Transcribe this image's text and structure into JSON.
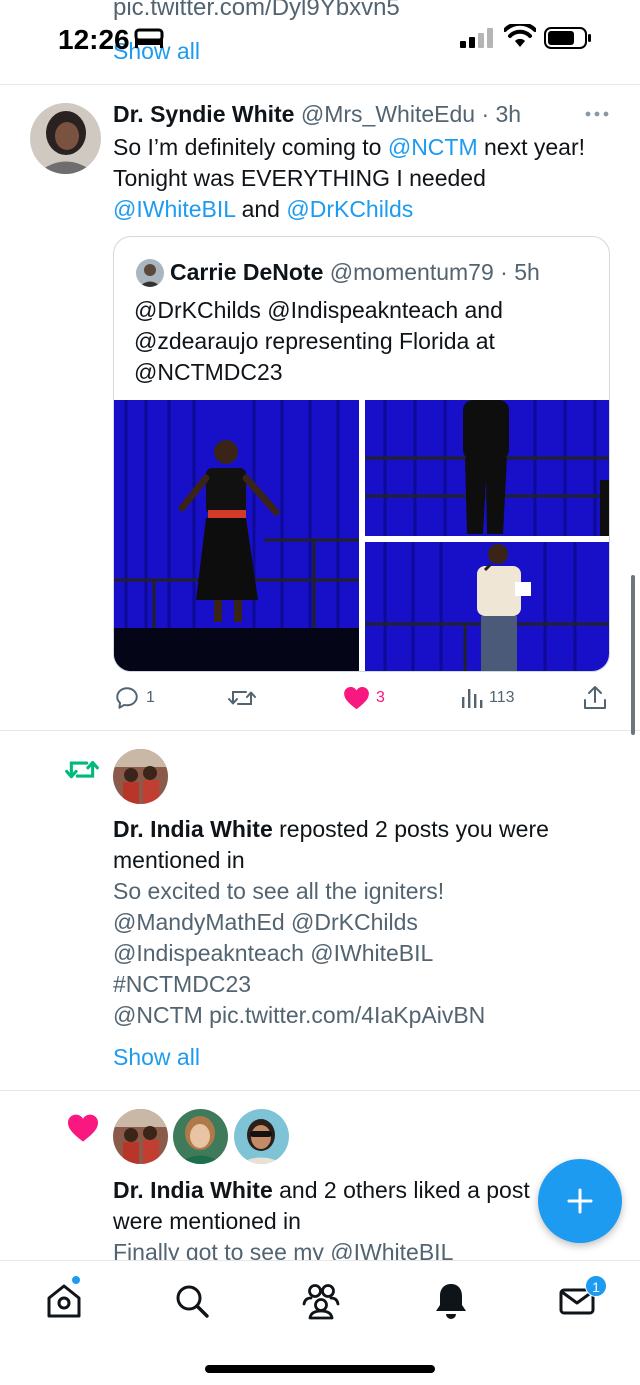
{
  "status": {
    "time": "12:26"
  },
  "top": {
    "bleed_text": "pic.twitter.com/Dyl9Ybxvn5",
    "show_all": "Show all"
  },
  "tweet": {
    "author": "Dr. Syndie White",
    "handle": "@Mrs_WhiteEdu",
    "time": "· 3h",
    "text": {
      "l1_pre": "So I’m definitely coming to ",
      "l1_mention": "@NCTM",
      "l1_post": " next year!",
      "l2": "Tonight was EVERYTHING  I needed",
      "l3_mention1": "@IWhiteBIL",
      "l3_and": "  and ",
      "l3_mention2": "@DrKChilds"
    },
    "quote": {
      "author": "Carrie DeNote",
      "handle": "@momentum79",
      "time": "· 5h",
      "lines": [
        "@DrKChilds @Indispeaknteach and",
        "@zdearaujo representing Florida at",
        "@NCTMDC23"
      ]
    },
    "actions": {
      "replies": "1",
      "reposts": "",
      "likes": "3",
      "views": "113"
    },
    "colors": {
      "like": "#f91880",
      "link": "#1d9bf0"
    }
  },
  "notif1": {
    "actor": "Dr. India White",
    "action": " reposted 2 posts you were",
    "action2": "mentioned in",
    "preview": [
      "So excited to see all the igniters!",
      "@MandyMathEd @DrKChilds",
      "@Indispeaknteach @IWhiteBIL",
      "#NCTMDC23",
      "@NCTM pic.twitter.com/4IaKpAivBN"
    ],
    "show_all": "Show all",
    "icon": "repost-icon",
    "color": "#00ba7c"
  },
  "notif2": {
    "actor": "Dr. India White",
    "action": " and 2 others liked a post",
    "action2": "were mentioned in",
    "preview": "Finally got to see my @IWhiteBIL",
    "icon": "heart-icon",
    "color": "#f91880"
  },
  "nav": {
    "messages_badge": "1",
    "items": [
      "home-icon",
      "search-icon",
      "communities-icon",
      "notifications-icon",
      "messages-icon"
    ]
  }
}
